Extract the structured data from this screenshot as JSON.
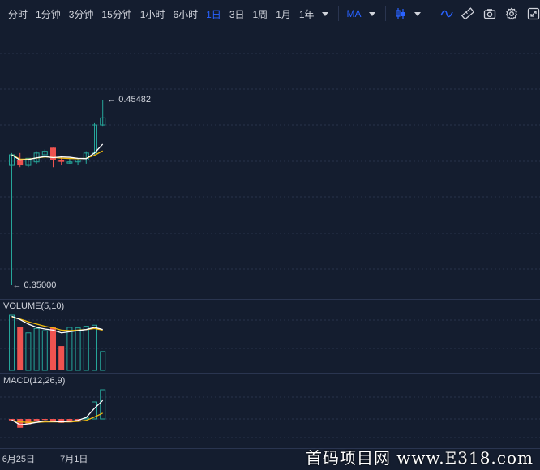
{
  "toolbar": {
    "intervals": [
      {
        "label": "分时",
        "active": false
      },
      {
        "label": "1分钟",
        "active": false
      },
      {
        "label": "3分钟",
        "active": false
      },
      {
        "label": "15分钟",
        "active": false
      },
      {
        "label": "1小时",
        "active": false
      },
      {
        "label": "6小时",
        "active": false
      },
      {
        "label": "1日",
        "active": true
      },
      {
        "label": "3日",
        "active": false
      },
      {
        "label": "1周",
        "active": false
      },
      {
        "label": "1月",
        "active": false
      },
      {
        "label": "1年",
        "active": false
      }
    ],
    "indicator_label": "MA",
    "icons": [
      "candlestick-type-icon",
      "line-drawing-icon",
      "ruler-icon",
      "camera-icon",
      "gear-icon",
      "fullscreen-icon"
    ]
  },
  "main_chart": {
    "high_label": "← 0.45482",
    "low_label": "← 0.35000"
  },
  "volume_pane": {
    "label": "VOLUME(5,10)"
  },
  "macd_pane": {
    "label": "MACD(12,26,9)"
  },
  "x_axis": {
    "ticks": [
      "6月25日",
      "7月1日"
    ]
  },
  "watermark": "首码项目网  www.E318.com",
  "colors": {
    "up": "#26a69a",
    "down": "#ef5350",
    "ma1": "#ffffff",
    "ma2": "#f0b90b",
    "accent": "#2962ff",
    "background": "#141d2f"
  },
  "chart_data": {
    "type": "candlestick",
    "candles": [
      {
        "o": 0.418,
        "h": 0.425,
        "l": 0.35,
        "c": 0.424
      },
      {
        "o": 0.421,
        "h": 0.425,
        "l": 0.417,
        "c": 0.418
      },
      {
        "o": 0.418,
        "h": 0.422,
        "l": 0.417,
        "c": 0.422
      },
      {
        "o": 0.42,
        "h": 0.426,
        "l": 0.419,
        "c": 0.425
      },
      {
        "o": 0.424,
        "h": 0.427,
        "l": 0.422,
        "c": 0.426
      },
      {
        "o": 0.428,
        "h": 0.428,
        "l": 0.417,
        "c": 0.421
      },
      {
        "o": 0.421,
        "h": 0.423,
        "l": 0.418,
        "c": 0.42
      },
      {
        "o": 0.42,
        "h": 0.422,
        "l": 0.419,
        "c": 0.42
      },
      {
        "o": 0.42,
        "h": 0.422,
        "l": 0.418,
        "c": 0.421
      },
      {
        "o": 0.421,
        "h": 0.426,
        "l": 0.419,
        "c": 0.425
      },
      {
        "o": 0.425,
        "h": 0.442,
        "l": 0.424,
        "c": 0.441
      },
      {
        "o": 0.441,
        "h": 0.4548,
        "l": 0.44,
        "c": 0.445
      }
    ],
    "ma5": [
      0.424,
      0.421,
      0.4213,
      0.4223,
      0.423,
      0.4224,
      0.4228,
      0.4226,
      0.422,
      0.4218,
      0.425,
      0.43
    ],
    "ma10": [
      0.424,
      0.4215,
      0.4215,
      0.4222,
      0.4228,
      0.4225,
      0.4221,
      0.4219,
      0.4218,
      0.422,
      0.4237,
      0.4262
    ],
    "volume": {
      "values": [
        100,
        78,
        68,
        76,
        72,
        78,
        44,
        78,
        77,
        80,
        82,
        34
      ],
      "ma5": [
        98,
        92,
        84,
        78,
        75,
        73,
        68,
        70,
        72,
        74,
        78,
        74
      ],
      "ma10": [
        96,
        93,
        88,
        84,
        80,
        77,
        73,
        72,
        73,
        74,
        76,
        73
      ]
    },
    "macd": {
      "hist": [
        -0.3,
        -1.8,
        -1.1,
        -0.5,
        -0.2,
        -0.6,
        -0.8,
        -0.7,
        -0.4,
        0.2,
        3.5,
        6.0
      ],
      "dif": [
        -0.2,
        -1.2,
        -1.0,
        -0.7,
        -0.4,
        -0.5,
        -0.6,
        -0.5,
        -0.3,
        0.3,
        2.2,
        3.8
      ],
      "dea": [
        -0.3,
        -0.6,
        -0.7,
        -0.7,
        -0.6,
        -0.6,
        -0.6,
        -0.6,
        -0.5,
        -0.3,
        0.4,
        1.2
      ]
    },
    "price_range": [
      0.35,
      0.4548
    ],
    "x_ticks": [
      {
        "index": 1,
        "label": "6月25日"
      },
      {
        "index": 8,
        "label": "7月1日"
      }
    ]
  }
}
